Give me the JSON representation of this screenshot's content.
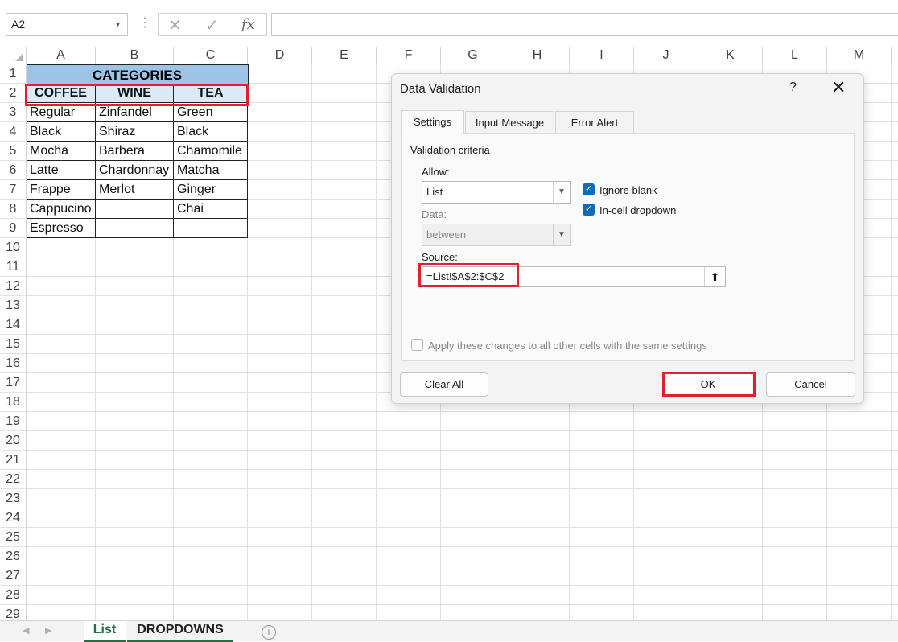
{
  "formula_bar": {
    "name_box": "A2",
    "cancel_glyph": "✕",
    "enter_glyph": "✓",
    "fx_label": "fx",
    "formula": ""
  },
  "columns": [
    "A",
    "B",
    "C",
    "D",
    "E",
    "F",
    "G",
    "H",
    "I",
    "J",
    "K",
    "L",
    "M"
  ],
  "rows": [
    "1",
    "2",
    "3",
    "4",
    "5",
    "6",
    "7",
    "8",
    "9",
    "10",
    "11",
    "12",
    "13",
    "14",
    "15",
    "16",
    "17",
    "18",
    "19",
    "20",
    "21",
    "22",
    "23",
    "24",
    "25",
    "26",
    "27",
    "28",
    "29"
  ],
  "sheet": {
    "category_title": "CATEGORIES",
    "headers": [
      "COFFEE",
      "WINE",
      "TEA"
    ],
    "data": [
      [
        "Regular",
        "Zinfandel",
        "Green"
      ],
      [
        "Black",
        "Shiraz",
        "Black"
      ],
      [
        "Mocha",
        "Barbera",
        "Chamomile"
      ],
      [
        "Latte",
        "Chardonnay",
        "Matcha"
      ],
      [
        "Frappe",
        "Merlot",
        "Ginger"
      ],
      [
        "Cappucino",
        "",
        "Chai"
      ],
      [
        "Espresso",
        "",
        ""
      ]
    ]
  },
  "sheet_tabs": {
    "active": "List",
    "other": "DROPDOWNS",
    "add_glyph": "+"
  },
  "dialog": {
    "title": "Data Validation",
    "help_glyph": "?",
    "close_glyph": "✕",
    "tabs": [
      "Settings",
      "Input Message",
      "Error Alert"
    ],
    "section_label": "Validation criteria",
    "allow_label": "Allow:",
    "allow_value": "List",
    "data_label": "Data:",
    "data_value": "between",
    "ignore_blank_label": "Ignore blank",
    "ignore_blank_checked": true,
    "in_cell_dropdown_label": "In-cell dropdown",
    "in_cell_dropdown_checked": true,
    "source_label": "Source:",
    "source_value": "=List!$A$2:$C$2",
    "apply_all_label": "Apply these changes to all other cells with the same settings",
    "apply_all_checked": false,
    "clear_all_label": "Clear All",
    "ok_label": "OK",
    "cancel_label": "Cancel"
  },
  "colors": {
    "accent": "#0f6cbd",
    "highlight": "#e1202d",
    "category_fill": "#9dc3e6",
    "header_fill": "#dce9f6",
    "sheet_tab_green": "#217346"
  }
}
